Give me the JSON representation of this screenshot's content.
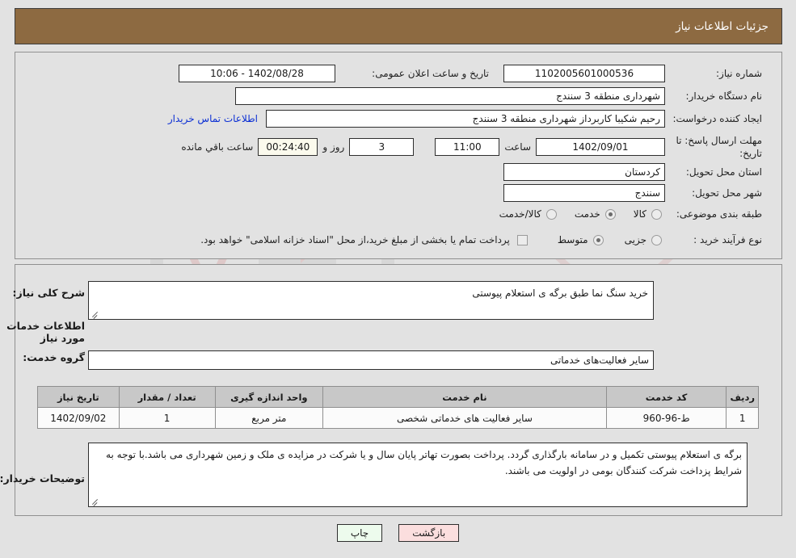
{
  "header": {
    "title": "جزئیات اطلاعات نیاز"
  },
  "form": {
    "need_number_label": "شماره نیاز:",
    "need_number_value": "1102005601000536",
    "announce_datetime_label": "تاریخ و ساعت اعلان عمومی:",
    "announce_datetime_value": "1402/08/28 - 10:06",
    "buyer_org_label": "نام دستگاه خریدار:",
    "buyer_org_value": "شهرداری منطقه 3 سنندج",
    "creator_label": "ایجاد کننده درخواست:",
    "creator_value": "رحیم شکیبا کاربرداز شهرداری منطقه 3 سنندج",
    "contact_link": "اطلاعات تماس خریدار",
    "deadline_label": "مهلت ارسال پاسخ: تا تاریخ:",
    "deadline_date": "1402/09/01",
    "deadline_hour_label": "ساعت",
    "deadline_hour": "11:00",
    "days_remaining": "3",
    "days_remaining_label": "روز و",
    "countdown": "00:24:40",
    "countdown_label": "ساعت باقي مانده",
    "province_label": "استان محل تحویل:",
    "province_value": "کردستان",
    "city_label": "شهر محل تحویل:",
    "city_value": "سنندج",
    "category_label": "طبقه بندی موضوعی:",
    "category_options": [
      "کالا",
      "خدمت",
      "کالا/خدمت"
    ],
    "category_selected_index": 1,
    "process_label": "نوع فرآیند خرید :",
    "process_options": [
      "جزیی",
      "متوسط"
    ],
    "process_selected_index": 1,
    "treasury_checkbox_checked": false,
    "treasury_text": "پرداخت تمام یا بخشی از مبلغ خرید،از محل \"اسناد خزانه اسلامی\" خواهد بود."
  },
  "description": {
    "need_summary_label": "شرح کلی نیاز:",
    "need_summary_value": "خرید سنگ نما طبق برگه ی استعلام پیوستی",
    "services_section_title": "اطلاعات خدمات مورد نیاز",
    "service_group_label": "گروه خدمت:",
    "service_group_value": "سایر فعالیت‌های خدماتی"
  },
  "table": {
    "headers": [
      "ردیف",
      "کد خدمت",
      "نام خدمت",
      "واحد اندازه گیری",
      "تعداد / مقدار",
      "تاریخ نیاز"
    ],
    "rows": [
      {
        "row_number": "1",
        "service_code": "ط-96-960",
        "service_name": "سایر فعالیت های خدماتی شخصی",
        "unit": "متر مربع",
        "quantity": "1",
        "need_date": "1402/09/02"
      }
    ]
  },
  "buyer_notes": {
    "label": "توضیحات خریدار:",
    "value": "برگه ی استعلام پیوستی تکمیل و در سامانه بارگذاری گردد. پرداخت بصورت تهاتر پایان سال و یا شرکت در مزایده ی ملک و زمین شهرداری می باشد.با توجه به شرایط پزداخت شرکت کنندگان بومی در اولویت می باشند."
  },
  "footer": {
    "print_label": "چاپ",
    "back_label": "بازگشت"
  },
  "watermark": {
    "text": "AriaTender.net"
  },
  "colors": {
    "header_bar": "#8d6a41",
    "page_background": "#e2e2e2",
    "link": "#0b2fd4",
    "table_header": "#c8c8c8",
    "print_button": "#edfbed",
    "back_button": "#fbdede"
  }
}
